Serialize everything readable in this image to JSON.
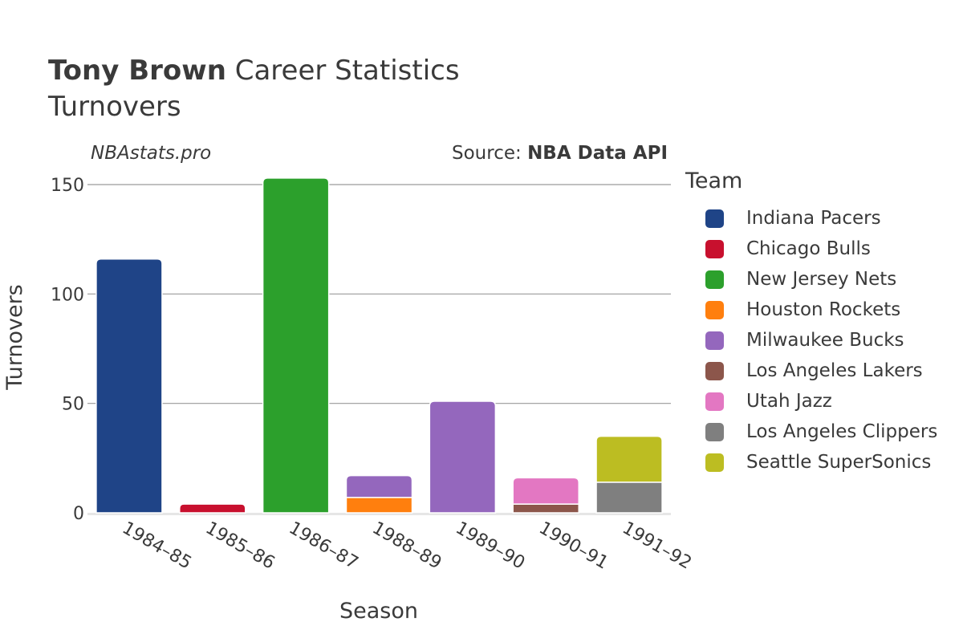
{
  "header": {
    "player_name": "Tony Brown",
    "title_rest": " Career Statistics",
    "subtitle": "Turnovers",
    "brand": "NBAstats.pro",
    "source_prefix": "Source: ",
    "source_name": "NBA Data API"
  },
  "chart_data": {
    "type": "bar",
    "stacked": true,
    "title": "Tony Brown Career Statistics",
    "subtitle": "Turnovers",
    "xlabel": "Season",
    "ylabel": "Turnovers",
    "ylim": [
      0,
      155
    ],
    "yticks": [
      0,
      50,
      100,
      150
    ],
    "grid": true,
    "legend_title": "Team",
    "legend_position": "right",
    "categories": [
      "1984–85",
      "1985–86",
      "1986–87",
      "1988–89",
      "1989–90",
      "1990–91",
      "1991–92"
    ],
    "series": [
      {
        "name": "Indiana Pacers",
        "color": "#1f4487",
        "values": [
          116,
          0,
          0,
          0,
          0,
          0,
          0
        ]
      },
      {
        "name": "Chicago Bulls",
        "color": "#c8102e",
        "values": [
          0,
          4,
          0,
          0,
          0,
          0,
          0
        ]
      },
      {
        "name": "New Jersey Nets",
        "color": "#2ca02c",
        "values": [
          0,
          0,
          153,
          0,
          0,
          0,
          0
        ]
      },
      {
        "name": "Houston Rockets",
        "color": "#ff7f0e",
        "values": [
          0,
          0,
          0,
          7,
          0,
          0,
          0
        ]
      },
      {
        "name": "Milwaukee Bucks",
        "color": "#9467bd",
        "values": [
          0,
          0,
          0,
          10,
          51,
          0,
          0
        ]
      },
      {
        "name": "Los Angeles Lakers",
        "color": "#8c564b",
        "values": [
          0,
          0,
          0,
          0,
          0,
          4,
          0
        ]
      },
      {
        "name": "Utah Jazz",
        "color": "#e377c2",
        "values": [
          0,
          0,
          0,
          0,
          0,
          12,
          0
        ]
      },
      {
        "name": "Los Angeles Clippers",
        "color": "#7f7f7f",
        "values": [
          0,
          0,
          0,
          0,
          0,
          0,
          14
        ]
      },
      {
        "name": "Seattle SuperSonics",
        "color": "#bcbd22",
        "values": [
          0,
          0,
          0,
          0,
          0,
          0,
          21
        ]
      }
    ]
  }
}
